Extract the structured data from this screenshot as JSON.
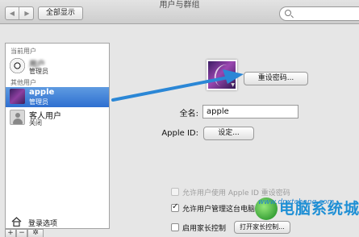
{
  "window": {
    "title": "用户与群组"
  },
  "toolbar": {
    "back_label": "◀",
    "forward_label": "▶",
    "show_all_label": "全部显示",
    "search_placeholder": ""
  },
  "sidebar": {
    "current_user_header": "当前用户",
    "current_user": {
      "name": "用户",
      "role": "管理员",
      "avatar": "soccer-ball"
    },
    "other_users_header": "其他用户",
    "users": [
      {
        "name": "apple",
        "role": "管理员",
        "selected": true,
        "avatar": "purple-abstract"
      },
      {
        "name": "客人用户",
        "role": "关闭",
        "selected": false,
        "avatar": "guest-silhouette"
      }
    ],
    "login_options_label": "登录选项",
    "add_label": "+",
    "remove_label": "−",
    "action_label": "✲"
  },
  "detail": {
    "reset_password_label": "重设密码...",
    "full_name_label": "全名:",
    "full_name_value": "apple",
    "apple_id_label": "Apple ID:",
    "set_button_label": "设定...",
    "checkboxes": [
      {
        "label": "允许用户使用 Apple ID 重设密码",
        "checked": false,
        "disabled": true
      },
      {
        "label": "允许用户管理这台电脑",
        "checked": true,
        "disabled": false
      },
      {
        "label": "启用家长控制",
        "checked": false,
        "disabled": false
      }
    ],
    "parental_open_label": "打开家长控制..."
  },
  "watermark": {
    "title": "电脑系统城",
    "url": "www.dnxtcheng.com"
  },
  "colors": {
    "selection": "#2e6fd0",
    "annotation_arrow": "#2b87d6",
    "watermark": "#1e8fd5"
  }
}
